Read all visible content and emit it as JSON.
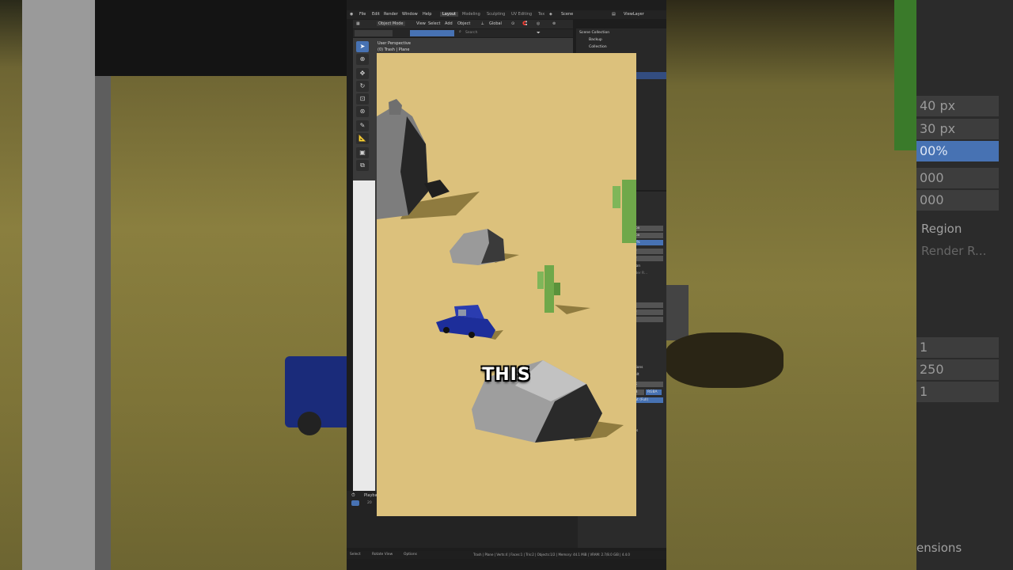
{
  "topbar": {
    "menus": [
      "File",
      "Edit",
      "Render",
      "Window",
      "Help"
    ],
    "workspaces": [
      "Layout",
      "Modeling",
      "Sculpting",
      "UV Editing",
      "Tex"
    ],
    "active_workspace": "Layout",
    "scene": "Scene",
    "view_layer": "ViewLayer"
  },
  "viewport_header": {
    "mode": "Object Mode",
    "menus": [
      "View",
      "Select",
      "Add",
      "Object"
    ],
    "orientation": "Global",
    "search_placeholder": "Search"
  },
  "viewport_overlay": {
    "perspective": "User Perspective",
    "object": "(0) Trash | Plane"
  },
  "tools": [
    "select",
    "cursor",
    "move",
    "rotate",
    "scale",
    "transform",
    "annotate",
    "measure",
    "add-cube",
    "add-object"
  ],
  "outliner": {
    "search_placeholder": "Search",
    "root": "Scene Collection",
    "items": [
      "Backup",
      "Collection"
    ]
  },
  "properties": {
    "values": [
      "40 px",
      "30 px",
      "100%",
      "000",
      "000"
    ],
    "region_label": "Region",
    "render_region_label": "Render R...",
    "frame_values": [
      "1",
      "250",
      "1"
    ],
    "output_labels": [
      "tensions",
      "Result",
      "EXR",
      "Float (Full)",
      "ers",
      "oders"
    ],
    "color_modes": [
      "RGB",
      "RGBA"
    ]
  },
  "timeline": {
    "menu": "Playba",
    "frame": "20"
  },
  "statusbar": {
    "left": [
      "Select",
      "Rotate View",
      "Options"
    ],
    "right": "Trash | Plane | Verts:4 | Faces:1 | Tris:2 | Objects:1/2 | Memory: 44.1 MiB | VRAM: 2.7/8.0 GiB | 4.4.0"
  },
  "background_right": {
    "rows": [
      "40 px",
      "30 px",
      "00%",
      "000",
      "000"
    ],
    "region": "Region",
    "render_region": "Render R...",
    "frames": [
      "1",
      "250",
      "1"
    ],
    "extensions": "ensions"
  },
  "caption": "THIS",
  "colors": {
    "accent": "#4772b3",
    "sand": "#dcc17c",
    "rock": "#8e8e8e",
    "cactus": "#6fa84a",
    "car": "#1d2e9a"
  }
}
